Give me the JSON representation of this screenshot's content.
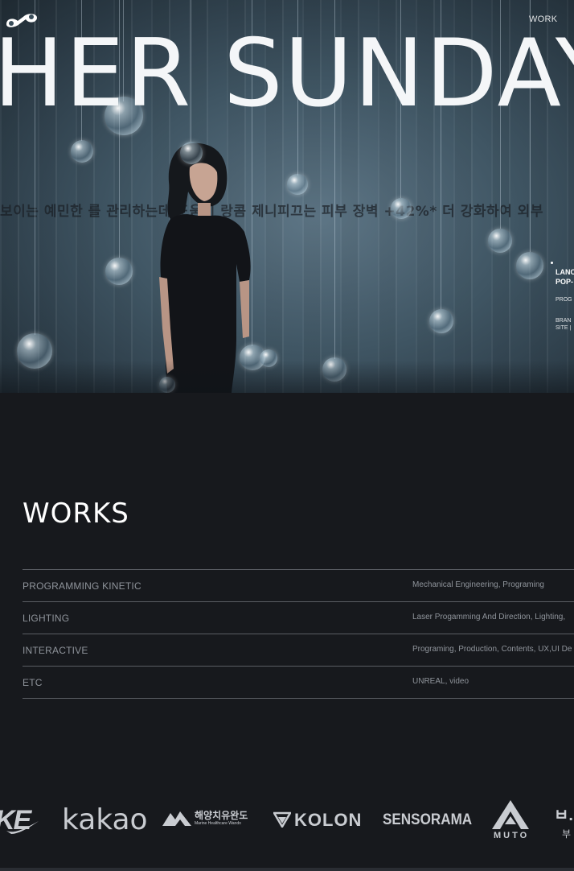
{
  "header": {
    "nav_work": "WORK"
  },
  "hero": {
    "title": "HER SUNDAY",
    "background_text": "보이는 예민한 를 관리하는데 도움이  랑콤 제니피끄는 피부 장벽 +42%* 더 강화하여 외부",
    "side_info": {
      "title_line1": "LANC",
      "title_line2": "POP-",
      "category": "PROG",
      "meta_line1": "BRAN",
      "meta_line2": "SITE |"
    }
  },
  "works": {
    "title": "WORKS",
    "rows": [
      {
        "category": "PROGRAMMING KINETIC",
        "description": "Mechanical Engineering, Programing"
      },
      {
        "category": "LIGHTING",
        "description": "Laser Progamming And Direction, Lighting,"
      },
      {
        "category": "INTERACTIVE",
        "description": "Programing, Production, Contents, UX,UI De"
      },
      {
        "category": "ETC",
        "description": "UNREAL, video"
      }
    ]
  },
  "clients": {
    "nike": "KE",
    "kakao": "kakao",
    "haeyang_ko": "해양치유완도",
    "haeyang_en": "Marine Healthcare Wando",
    "kolon": "KOLON",
    "sensorama": "SENSORAMA",
    "muto": "MUTO",
    "last_main": "ㅂ.",
    "last_sub": "부"
  },
  "colors": {
    "page_background": "#17191d",
    "text_primary": "#ffffff",
    "text_muted": "#8f949b",
    "divider": "#5a5d63",
    "logo_grey": "#c9ccd1"
  },
  "icons": {
    "brand_logo": "infinity-loop-logo",
    "kolon_mark": "kolon-triangle-mark",
    "haeyang_mark": "mountain-wave-mark",
    "muto_mark": "muto-a-mark"
  }
}
